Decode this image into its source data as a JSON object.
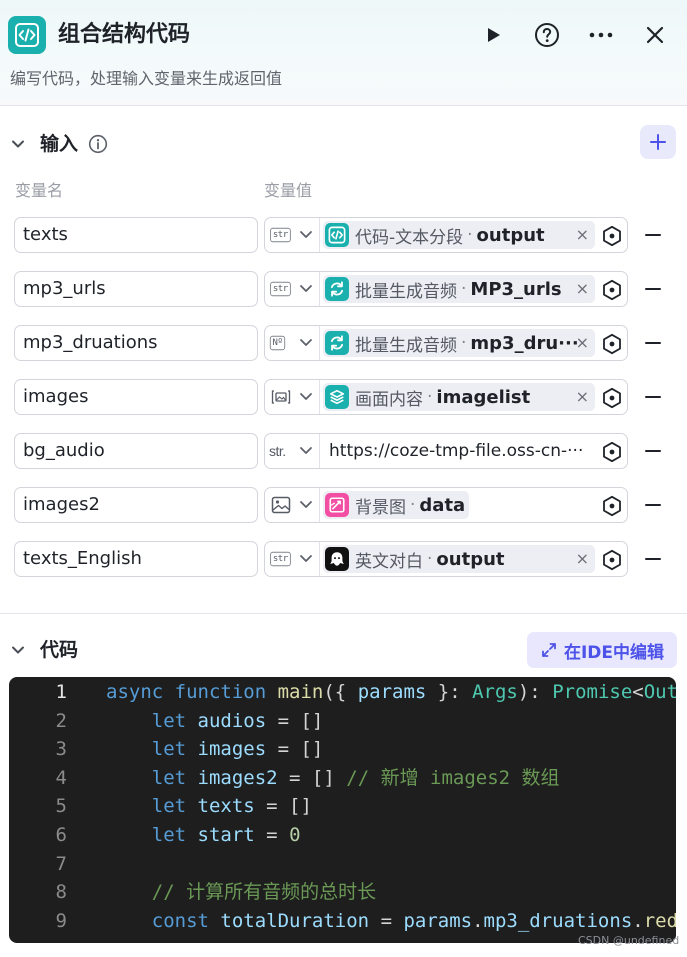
{
  "header": {
    "title": "组合结构代码",
    "subtitle": "编写代码，处理输入变量来生成返回值"
  },
  "input_section": {
    "title": "输入",
    "col_name": "变量名",
    "col_value": "变量值"
  },
  "variables": [
    {
      "name": "texts",
      "type": "str",
      "ref_node": "代码-文本分段",
      "ref_field": "output",
      "icon": "code-node-icon",
      "color": "#19b0ae"
    },
    {
      "name": "mp3_urls",
      "type": "str",
      "ref_node": "批量生成音频",
      "ref_field": "MP3_urls",
      "icon": "loop-node-icon",
      "color": "#19b0ae"
    },
    {
      "name": "mp3_druations",
      "type": "Nº",
      "ref_node": "批量生成音频",
      "ref_field": "mp3_dru···",
      "icon": "loop-node-icon",
      "color": "#19b0ae"
    },
    {
      "name": "images",
      "type": "img-list",
      "ref_node": "画面内容",
      "ref_field": "imagelist",
      "icon": "layers-node-icon",
      "color": "#19b0ae"
    },
    {
      "name": "bg_audio",
      "type": "str.",
      "url": "https://coze-tmp-file.oss-cn-···"
    },
    {
      "name": "images2",
      "type": "image",
      "ref_node": "背景图",
      "ref_field": "data",
      "icon": "image-node-icon",
      "color": "#f24fa4"
    },
    {
      "name": "texts_English",
      "type": "str",
      "ref_node": "英文对白",
      "ref_field": "output",
      "icon": "bot-node-icon",
      "color": "#111111"
    }
  ],
  "code_section": {
    "title": "代码",
    "ide_label": "在IDE中编辑"
  },
  "code_lines": [
    {
      "n": "1",
      "segs": [
        [
          "kw",
          "async "
        ],
        [
          "kw",
          "function "
        ],
        [
          "fn",
          "main"
        ],
        [
          "",
          "({ "
        ],
        [
          "var",
          "params"
        ],
        [
          "",
          " }: "
        ],
        [
          "ty",
          "Args"
        ],
        [
          "",
          "): "
        ],
        [
          "ty",
          "Promise"
        ],
        [
          "",
          "<"
        ],
        [
          "ty",
          "Out"
        ]
      ]
    },
    {
      "n": "2",
      "segs": [
        [
          "",
          "    "
        ],
        [
          "kw",
          "let "
        ],
        [
          "var",
          "audios"
        ],
        [
          "",
          " = []"
        ]
      ]
    },
    {
      "n": "3",
      "segs": [
        [
          "",
          "    "
        ],
        [
          "kw",
          "let "
        ],
        [
          "var",
          "images"
        ],
        [
          "",
          " = []"
        ]
      ]
    },
    {
      "n": "4",
      "segs": [
        [
          "",
          "    "
        ],
        [
          "kw",
          "let "
        ],
        [
          "var",
          "images2"
        ],
        [
          "",
          " = [] "
        ],
        [
          "cm",
          "// 新增 images2 数组"
        ]
      ]
    },
    {
      "n": "5",
      "segs": [
        [
          "",
          "    "
        ],
        [
          "kw",
          "let "
        ],
        [
          "var",
          "texts"
        ],
        [
          "",
          " = []"
        ]
      ]
    },
    {
      "n": "6",
      "segs": [
        [
          "",
          "    "
        ],
        [
          "kw",
          "let "
        ],
        [
          "var",
          "start"
        ],
        [
          "",
          " = "
        ],
        [
          "num",
          "0"
        ]
      ]
    },
    {
      "n": "7",
      "segs": []
    },
    {
      "n": "8",
      "segs": [
        [
          "",
          "    "
        ],
        [
          "cm",
          "// 计算所有音频的总时长"
        ]
      ]
    },
    {
      "n": "9",
      "segs": [
        [
          "",
          "    "
        ],
        [
          "kw",
          "const "
        ],
        [
          "var",
          "totalDuration"
        ],
        [
          "",
          " = "
        ],
        [
          "var",
          "params"
        ],
        [
          "",
          "."
        ],
        [
          "var",
          "mp3_druations"
        ],
        [
          "",
          "."
        ],
        [
          "fn",
          "red"
        ]
      ]
    }
  ],
  "watermark": "CSDN @undefined"
}
